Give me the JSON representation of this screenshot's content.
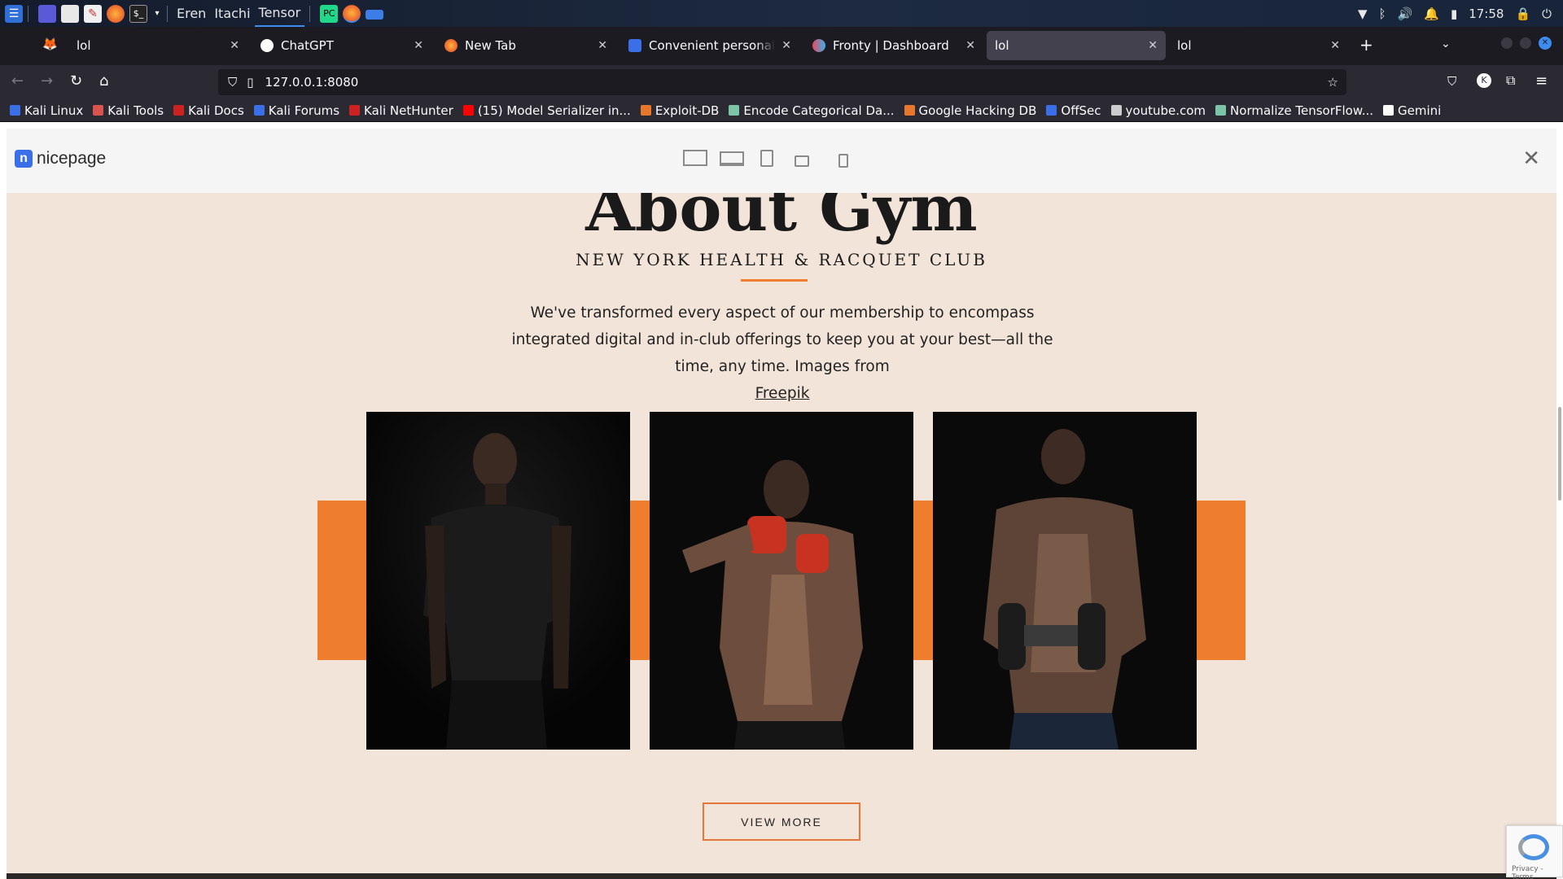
{
  "os_bar": {
    "workspaces": [
      "Eren",
      "Itachi",
      "Tensor"
    ],
    "clock": "17:58"
  },
  "tabs": [
    {
      "label": "lol",
      "favicon": "firefox-icon",
      "active": false
    },
    {
      "label": "ChatGPT",
      "favicon": "chatgpt-icon",
      "active": false
    },
    {
      "label": "New Tab",
      "favicon": "firefox-icon",
      "active": false
    },
    {
      "label": "Convenient personal train",
      "favicon": "nicepage-icon",
      "active": false
    },
    {
      "label": "Fronty | Dashboard",
      "favicon": "fronty-icon",
      "active": false
    },
    {
      "label": "lol",
      "favicon": "none",
      "active": true
    },
    {
      "label": "lol",
      "favicon": "none",
      "active": false
    }
  ],
  "nav": {
    "url": "127.0.0.1:8080"
  },
  "bookmarks": [
    {
      "label": "Kali Linux",
      "color": "#3a6fe8"
    },
    {
      "label": "Kali Tools",
      "color": "#d9534f"
    },
    {
      "label": "Kali Docs",
      "color": "#cc2222"
    },
    {
      "label": "Kali Forums",
      "color": "#3a6fe8"
    },
    {
      "label": "Kali NetHunter",
      "color": "#cc2222"
    },
    {
      "label": "(15) Model Serializer in...",
      "color": "#ff0000"
    },
    {
      "label": "Exploit-DB",
      "color": "#e8772e"
    },
    {
      "label": "Encode Categorical Da...",
      "color": "#7bc4a8"
    },
    {
      "label": "Google Hacking DB",
      "color": "#e8772e"
    },
    {
      "label": "OffSec",
      "color": "#3a6fe8"
    },
    {
      "label": "youtube.com",
      "color": "#cccccc"
    },
    {
      "label": "Normalize TensorFlow...",
      "color": "#7bc4a8"
    },
    {
      "label": "Gemini",
      "color": "#ffffff"
    }
  ],
  "preview": {
    "brand": "nicepage",
    "devices": [
      "desktop-icon",
      "laptop-icon",
      "tablet-portrait-icon",
      "tablet-landscape-icon",
      "phone-icon"
    ]
  },
  "page": {
    "title": "About Gym",
    "subtitle": "NEW YORK HEALTH & RACQUET CLUB",
    "description": "We've transformed every aspect of our membership to encompass integrated digital and in-club offerings to keep you at your best—all the time, any time.  Images from",
    "link_text": "Freepik",
    "button_label": "VIEW MORE",
    "accent": "#ef7d2e",
    "background": "#f2e4d9"
  },
  "recaptcha": {
    "footer": "Privacy - Terms"
  }
}
